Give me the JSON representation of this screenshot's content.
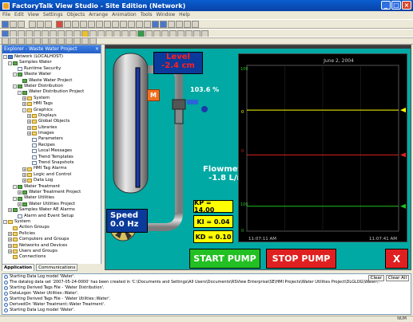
{
  "window": {
    "title": "FactoryTalk View Studio - Site Edition (Network)"
  },
  "menu": [
    "File",
    "Edit",
    "View",
    "Settings",
    "Objects",
    "Arrange",
    "Animation",
    "Tools",
    "Window",
    "Help"
  ],
  "explorer": {
    "title": "Explorer - Waste Water Project",
    "tree": [
      {
        "label": "Network (LOCALHOST)",
        "indent": 0,
        "exp": "-",
        "icon": "net"
      },
      {
        "label": "Samples Water",
        "indent": 1,
        "exp": "-",
        "icon": "app"
      },
      {
        "label": "Runtime Security",
        "indent": 2,
        "exp": "",
        "icon": "doc"
      },
      {
        "label": "Waste Water",
        "indent": 2,
        "exp": "-",
        "icon": "app"
      },
      {
        "label": "Waste Water Project",
        "indent": 3,
        "exp": "",
        "icon": "app"
      },
      {
        "label": "Water Distribution",
        "indent": 2,
        "exp": "-",
        "icon": "app"
      },
      {
        "label": "Water Distribution Project",
        "indent": 3,
        "exp": "-",
        "icon": "app"
      },
      {
        "label": "System",
        "indent": 4,
        "exp": "+",
        "icon": "folder"
      },
      {
        "label": "HMI Tags",
        "indent": 4,
        "exp": "+",
        "icon": "folder"
      },
      {
        "label": "Graphics",
        "indent": 4,
        "exp": "-",
        "icon": "folder"
      },
      {
        "label": "Displays",
        "indent": 5,
        "exp": "+",
        "icon": "folder"
      },
      {
        "label": "Global Objects",
        "indent": 5,
        "exp": "+",
        "icon": "folder"
      },
      {
        "label": "Libraries",
        "indent": 5,
        "exp": "+",
        "icon": "folder"
      },
      {
        "label": "Images",
        "indent": 5,
        "exp": "+",
        "icon": "folder"
      },
      {
        "label": "Parameters",
        "indent": 5,
        "exp": "",
        "icon": "doc"
      },
      {
        "label": "Recipes",
        "indent": 5,
        "exp": "",
        "icon": "doc"
      },
      {
        "label": "Local Messages",
        "indent": 5,
        "exp": "",
        "icon": "doc"
      },
      {
        "label": "Trend Templates",
        "indent": 5,
        "exp": "",
        "icon": "doc"
      },
      {
        "label": "Trend Snapshots",
        "indent": 5,
        "exp": "",
        "icon": "doc"
      },
      {
        "label": "HMI Tag Alarms",
        "indent": 4,
        "exp": "+",
        "icon": "folder"
      },
      {
        "label": "Logic and Control",
        "indent": 4,
        "exp": "+",
        "icon": "folder"
      },
      {
        "label": "Data Log",
        "indent": 4,
        "exp": "+",
        "icon": "folder"
      },
      {
        "label": "Water Treatment",
        "indent": 2,
        "exp": "-",
        "icon": "app"
      },
      {
        "label": "Water Treatment Project",
        "indent": 3,
        "exp": "+",
        "icon": "app"
      },
      {
        "label": "Water Utilities",
        "indent": 2,
        "exp": "-",
        "icon": "app"
      },
      {
        "label": "Water Utilities Project",
        "indent": 3,
        "exp": "+",
        "icon": "app"
      },
      {
        "label": "Samples Water AE Alarms",
        "indent": 1,
        "exp": "+",
        "icon": "app"
      },
      {
        "label": "Alarm and Event Setup",
        "indent": 2,
        "exp": "",
        "icon": "doc"
      },
      {
        "label": "System",
        "indent": 0,
        "exp": "-",
        "icon": "folder"
      },
      {
        "label": "Action Groups",
        "indent": 1,
        "exp": "",
        "icon": "folder"
      },
      {
        "label": "Policies",
        "indent": 1,
        "exp": "+",
        "icon": "folder"
      },
      {
        "label": "Computers and Groups",
        "indent": 1,
        "exp": "+",
        "icon": "folder"
      },
      {
        "label": "Networks and Devices",
        "indent": 1,
        "exp": "+",
        "icon": "folder"
      },
      {
        "label": "Users and Groups",
        "indent": 1,
        "exp": "+",
        "icon": "folder"
      },
      {
        "label": "Connections",
        "indent": 1,
        "exp": "",
        "icon": "folder"
      }
    ],
    "tabs": [
      "Application",
      "Communications"
    ]
  },
  "hmi": {
    "level_label": "Level",
    "level_value": "-2.4  cm",
    "m_button": "M",
    "valve_percent": "103.6 %",
    "flowmeter_label": "Flowmeter",
    "flowmeter_value": "-1.8 L/m",
    "speed_label": "Speed",
    "speed_value": "0.0 Hz",
    "kp": "KP = 14.00",
    "ki": "KI = 0.04",
    "kd": "KD = 0.10",
    "start_button": "START PUMP",
    "stop_button": "STOP PUMP",
    "close_button": "X",
    "colors": {
      "background": "#00A9A3",
      "start": "#22C022",
      "stop": "#E02020",
      "level_text": "#FF2020"
    }
  },
  "chart_data": {
    "type": "line",
    "title": "June 2, 2004",
    "x_range": [
      "11:07:11 AM",
      "11:07:41 AM"
    ],
    "y_range": [
      0,
      100
    ],
    "upper_ticks": [
      "0",
      "100"
    ],
    "lower_ticks": [
      "100",
      "0"
    ],
    "mid_ticks": [
      "0"
    ],
    "series": [
      {
        "color": "#FFFF00",
        "values": [
          73,
          73
        ]
      },
      {
        "color": "#E02020",
        "values": [
          46,
          46
        ]
      },
      {
        "color": "#22C022",
        "values": [
          15,
          15
        ]
      }
    ],
    "grid": true
  },
  "output": {
    "lines": [
      "Starting Data Log model 'Water'.",
      "The datalog data set '2007-05-24-0000' has been created in 'C:\\Documents and Settings\\All Users\\Documents\\RSView Enterprise\\SE\\HMI Projects\\Water Utilities Project\\DLGLOG\\Water\\'.",
      "Starting Derived Tags File - 'Water Distribution'.",
      "DataLogon 'Water Utilities::Water'.",
      "Starting Derived Tags File - 'Water Utilities::Water'.",
      "DerivedOn 'Water Treatment::Water Treatment'.",
      "Starting Data Log model 'Water'."
    ],
    "clear_button": "Clear",
    "clear_all_button": "Clear All"
  },
  "status": {
    "num": "NUM"
  }
}
